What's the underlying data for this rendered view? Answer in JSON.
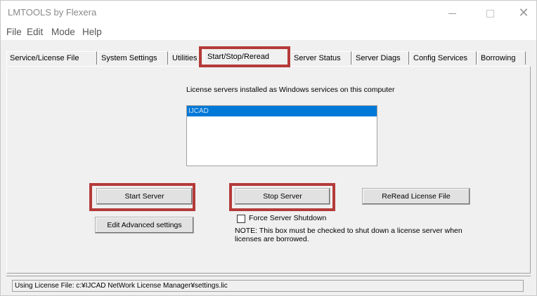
{
  "window": {
    "title": "LMTOOLS by Flexera",
    "controls": [
      "minimize",
      "maximize",
      "close"
    ],
    "close_glyph": "✕"
  },
  "menu": [
    "File",
    "Edit",
    "Mode",
    "Help"
  ],
  "tabs": [
    {
      "label": "Service/License File"
    },
    {
      "label": "System Settings"
    },
    {
      "label": "Utilities"
    },
    {
      "label": "Start/Stop/Reread",
      "active": true
    },
    {
      "label": "Server Status"
    },
    {
      "label": "Server Diags"
    },
    {
      "label": "Config Services"
    },
    {
      "label": "Borrowing"
    }
  ],
  "main": {
    "services_label": "License servers installed as Windows services on this computer",
    "services_list": [
      "IJCAD"
    ],
    "selected_service": "IJCAD",
    "buttons": {
      "start": "Start Server",
      "stop": "Stop Server",
      "reread": "ReRead License File",
      "advanced": "Edit Advanced settings"
    },
    "force_shutdown_label": "Force Server Shutdown",
    "force_shutdown_checked": false,
    "note": "NOTE:  This box must be checked to shut down a license server when licenses are borrowed."
  },
  "status_bar": "Using License File:  c:¥IJCAD NetWork License Manager¥settings.lic",
  "highlight_color": "#b53a3a",
  "selection_color": "#0078d7"
}
